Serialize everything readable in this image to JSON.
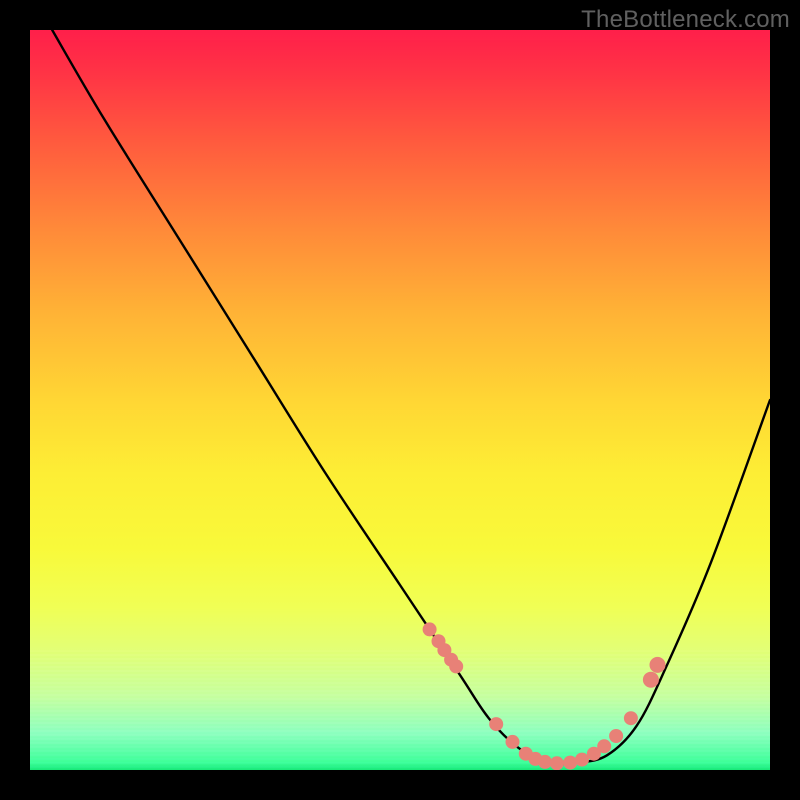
{
  "watermark": "TheBottleneck.com",
  "chart_data": {
    "type": "line",
    "title": "",
    "xlabel": "",
    "ylabel": "",
    "xlim": [
      0,
      100
    ],
    "ylim": [
      0,
      100
    ],
    "series": [
      {
        "name": "bottleneck-curve",
        "x": [
          3,
          10,
          20,
          30,
          40,
          50,
          58,
          62,
          66,
          70,
          74,
          78,
          82,
          86,
          92,
          100
        ],
        "y": [
          100,
          88,
          72,
          56,
          40,
          25,
          13,
          7,
          3,
          1,
          1,
          2,
          6,
          14,
          28,
          50
        ]
      }
    ],
    "marker_points": {
      "name": "highlighted-points",
      "color": "#e88177",
      "x": [
        54.0,
        55.2,
        56.0,
        56.9,
        57.6,
        63.0,
        65.2,
        67.0,
        68.3,
        69.6,
        71.2,
        73.0,
        74.6,
        76.2,
        77.6,
        79.2,
        81.2,
        83.9,
        84.8
      ],
      "y": [
        19.0,
        17.4,
        16.2,
        14.9,
        14.0,
        6.2,
        3.8,
        2.2,
        1.5,
        1.1,
        0.9,
        1.0,
        1.4,
        2.2,
        3.2,
        4.6,
        7.0,
        12.2,
        14.2
      ],
      "r": [
        7,
        7,
        7,
        7,
        7,
        7,
        7,
        7,
        7,
        7,
        7,
        7,
        7,
        7,
        7,
        7,
        7,
        8,
        8
      ]
    }
  }
}
